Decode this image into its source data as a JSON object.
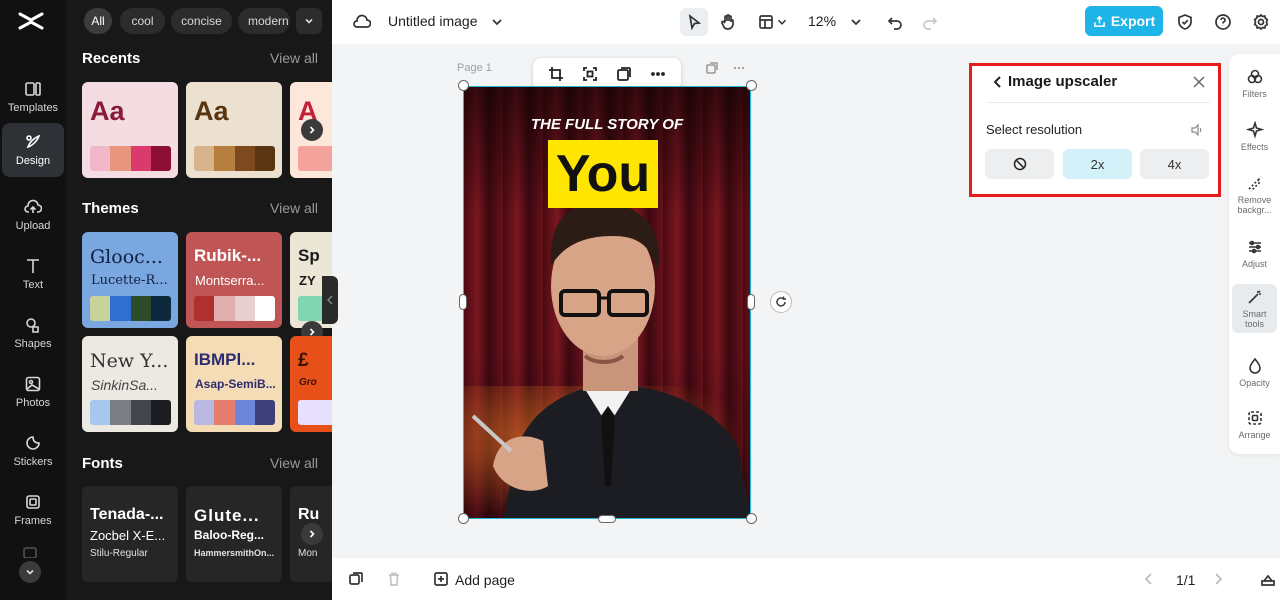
{
  "left_rail": {
    "items": [
      {
        "label": "Templates",
        "icon": "templates-icon"
      },
      {
        "label": "Design",
        "icon": "design-icon"
      },
      {
        "label": "Upload",
        "icon": "upload-icon"
      },
      {
        "label": "Text",
        "icon": "text-icon"
      },
      {
        "label": "Shapes",
        "icon": "shapes-icon"
      },
      {
        "label": "Photos",
        "icon": "photos-icon"
      },
      {
        "label": "Stickers",
        "icon": "stickers-icon"
      },
      {
        "label": "Frames",
        "icon": "frames-icon"
      }
    ],
    "active": "Design"
  },
  "panel": {
    "chips": [
      "All",
      "cool",
      "concise",
      "modern"
    ],
    "recents": {
      "title": "Recents",
      "view_all": "View all",
      "cards": [
        {
          "sample": "Aa",
          "sample_color": "#8a1a3a",
          "bg": "#f3dde2",
          "colors": [
            "#f0b8c8",
            "#e8957e",
            "#d93b6c",
            "#8a0f33"
          ]
        },
        {
          "sample": "Aa",
          "sample_color": "#5a3512",
          "bg": "#ece0d0",
          "colors": [
            "#d8b48c",
            "#b57d3e",
            "#7c4a1e",
            "#5a3512"
          ]
        },
        {
          "sample": "A",
          "sample_color": "#c0203a",
          "bg": "#fde6da",
          "colors": [
            "#f3a39b"
          ]
        }
      ]
    },
    "themes": {
      "title": "Themes",
      "view_all": "View all",
      "cards": [
        {
          "title": "Glooc...",
          "sub": "Lucette-R...",
          "bg": "#7aa7e0",
          "fg": "#0f2140",
          "colors": [
            "#c9d29a",
            "#2f6fd0",
            "#2e4b2a",
            "#0c2a3c"
          ]
        },
        {
          "title": "Rubik-...",
          "sub": "Montserra...",
          "bg": "#c05555",
          "fg": "#ffffff",
          "colors": [
            "#b03030",
            "#e0b0b0",
            "#e8d0d0",
            "#ffffff"
          ]
        },
        {
          "title": "Sp",
          "sub": "ZY",
          "bg": "#ece6d6",
          "fg": "#1a1a1a",
          "colors": [
            "#7fd6b0"
          ]
        },
        {
          "title": "New Y...",
          "sub": "SinkinSa...",
          "bg": "#ece8e2",
          "fg": "#333333",
          "colors": [
            "#a7c8ee",
            "#7b7f85",
            "#43474d",
            "#1b1d20"
          ]
        },
        {
          "title": "IBMPl...",
          "sub": "Asap-SemiB...",
          "bg": "#f4ddb6",
          "fg": "#2c2c6e",
          "colors": [
            "#b9b8e0",
            "#e77d6d",
            "#6d87d8",
            "#3f3f7c"
          ]
        },
        {
          "title": "£",
          "sub": "Gro",
          "bg": "#e8501a",
          "fg": "#3a1200",
          "colors": [
            "#e8e0ff"
          ]
        }
      ]
    },
    "fonts": {
      "title": "Fonts",
      "view_all": "View all",
      "cards": [
        {
          "l1": "Tenada-...",
          "l2": "Zocbel X-E...",
          "l3": "Stilu-Regular"
        },
        {
          "l1": "Glute...",
          "l2": "Baloo-Reg...",
          "l3": "HammersmithOn..."
        },
        {
          "l1": "Ru",
          "l2": "",
          "l3": "Mon"
        }
      ]
    }
  },
  "topbar": {
    "doc_title": "Untitled image",
    "zoom": "12%",
    "export_label": "Export"
  },
  "canvas": {
    "page_label": "Page 1",
    "headline": "THE FULL STORY OF",
    "you_text": "You"
  },
  "upscaler": {
    "title": "Image upscaler",
    "label": "Select resolution",
    "options": [
      "",
      "2x",
      "4x"
    ],
    "selected": "2x"
  },
  "right_tools": [
    {
      "label": "Filters"
    },
    {
      "label": "Effects"
    },
    {
      "label": "Remove backgr..."
    },
    {
      "label": "Adjust"
    },
    {
      "label": "Smart tools"
    },
    {
      "label": "Opacity"
    },
    {
      "label": "Arrange"
    }
  ],
  "bottombar": {
    "add_page": "Add page",
    "pagination": "1/1"
  },
  "colors": {
    "accent": "#1fb4e8",
    "highlight_border": "#e51d1d",
    "you_box": "#ffe600"
  }
}
